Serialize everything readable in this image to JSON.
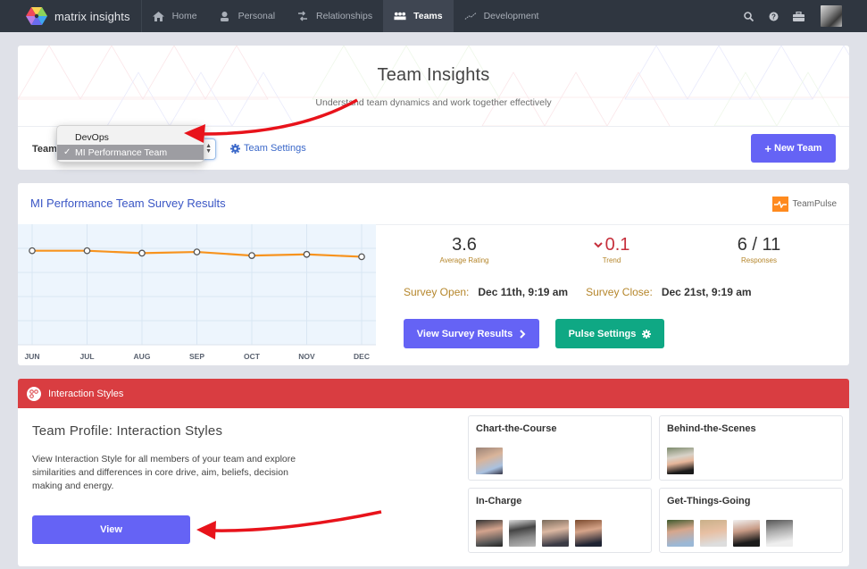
{
  "navbar": {
    "brand": "matrix insights",
    "items": [
      {
        "label": "Home",
        "icon": "home-icon",
        "active": false
      },
      {
        "label": "Personal",
        "icon": "user-icon",
        "active": false
      },
      {
        "label": "Relationships",
        "icon": "exchange-icon",
        "active": false
      },
      {
        "label": "Teams",
        "icon": "users-icon",
        "active": true
      },
      {
        "label": "Development",
        "icon": "trend-line-icon",
        "active": false
      }
    ],
    "right_icons": [
      "search-icon",
      "help-icon",
      "briefcase-icon",
      "user-avatar"
    ]
  },
  "hero": {
    "title": "Team Insights",
    "subtitle": "Understand team dynamics and work together effectively",
    "team_label": "Team",
    "team_select": {
      "options": [
        "DevOps",
        "MI Performance Team"
      ],
      "selected": "MI Performance Team",
      "check_mark": "✓"
    },
    "team_settings_label": "Team Settings",
    "new_team_label": "New Team"
  },
  "survey": {
    "title": "MI Performance Team Survey Results",
    "brand": "TeamPulse",
    "stats": [
      {
        "value": "3.6",
        "label": "Average Rating"
      },
      {
        "value": "0.1",
        "label": "Trend",
        "direction": "down"
      },
      {
        "value": "6 / 11",
        "label": "Responses"
      }
    ],
    "open_label": "Survey Open:",
    "open_value": "Dec 11th, 9:19 am",
    "close_label": "Survey Close:",
    "close_value": "Dec 21st, 9:19 am",
    "view_results_label": "View Survey Results",
    "pulse_settings_label": "Pulse Settings",
    "colors": {
      "line": "#f7931e",
      "primary": "#6563f5",
      "success": "#0fa884",
      "trend_down": "#c6303c"
    }
  },
  "chart_data": {
    "type": "line",
    "title": "",
    "xlabel": "",
    "ylabel": "",
    "categories": [
      "JUN",
      "JUL",
      "AUG",
      "SEP",
      "OCT",
      "NOV",
      "DEC"
    ],
    "series": [
      {
        "name": "Average Rating",
        "values": [
          3.9,
          3.9,
          3.8,
          3.85,
          3.7,
          3.75,
          3.65
        ]
      }
    ],
    "ylim": [
      0,
      5
    ],
    "grid": true,
    "legend": "none"
  },
  "interaction": {
    "header": "Interaction Styles",
    "profile_title": "Team Profile: Interaction Styles",
    "description": "View Interaction Style for all members of your team and explore similarities and differences in core drive, aim, beliefs, decision making and energy.",
    "view_label": "View",
    "styles": [
      {
        "name": "Chart-the-Course",
        "members": 1
      },
      {
        "name": "Behind-the-Scenes",
        "members": 1
      },
      {
        "name": "In-Charge",
        "members": 4
      },
      {
        "name": "Get-Things-Going",
        "members": 4
      }
    ]
  }
}
